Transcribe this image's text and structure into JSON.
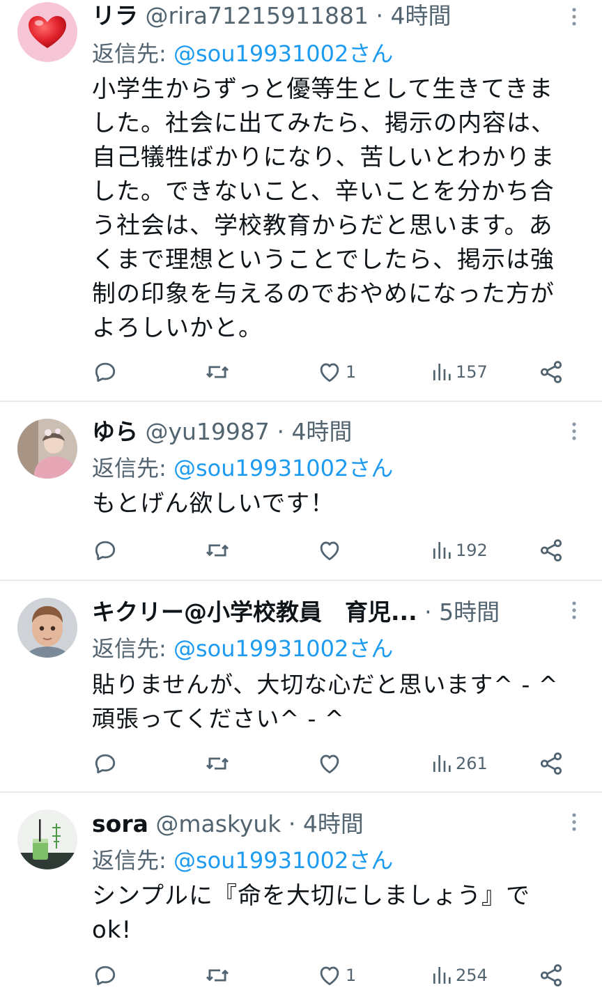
{
  "reply_prefix": "返信先: ",
  "tweets": [
    {
      "name": "リラ",
      "handle": "@rira71215911881",
      "dot": "·",
      "time": "4時間",
      "reply_to": "@sou19931002さん",
      "lines": [
        "小学生からずっと優等生として生きてきま",
        "した。社会に出てみたら、掲示の内容は、",
        "自己犠牲ばかりになり、苦しいとわかりま",
        "した。できないこと、辛いことを分かち合",
        "う社会は、学校教育からだと思います。あ",
        "くまで理想ということでしたら、掲示は強",
        "制の印象を与えるのでおやめになった方が",
        "よろしいかと。"
      ],
      "likes": "1",
      "views": "157",
      "avatar": "heart-icon"
    },
    {
      "name": "ゆら",
      "handle": "@yu19987",
      "dot": "·",
      "time": "4時間",
      "reply_to": "@sou19931002さん",
      "lines": [
        "もとげん欲しいです！"
      ],
      "likes": "",
      "views": "192",
      "avatar": "photo-person"
    },
    {
      "name": "キクリー@小学校教員　育児...",
      "handle": "",
      "dot": "·",
      "time": "5時間",
      "reply_to": "@sou19931002さん",
      "lines": [
        "貼りませんが、大切な心だと思います^ - ^",
        "頑張ってください^ - ^"
      ],
      "likes": "",
      "views": "261",
      "avatar": "3d-face"
    },
    {
      "name": "sora",
      "handle": "@maskyuk",
      "dot": "·",
      "time": "4時間",
      "reply_to": "@sou19931002さん",
      "lines": [
        "シンプルに『命を大切にしましょう』で",
        "ok!"
      ],
      "likes": "1",
      "views": "254",
      "avatar": "green-drink"
    }
  ],
  "colors": {
    "text": "#0f1419",
    "muted": "#536471",
    "link": "#1d9bf0",
    "divider": "#e6e8ea"
  }
}
